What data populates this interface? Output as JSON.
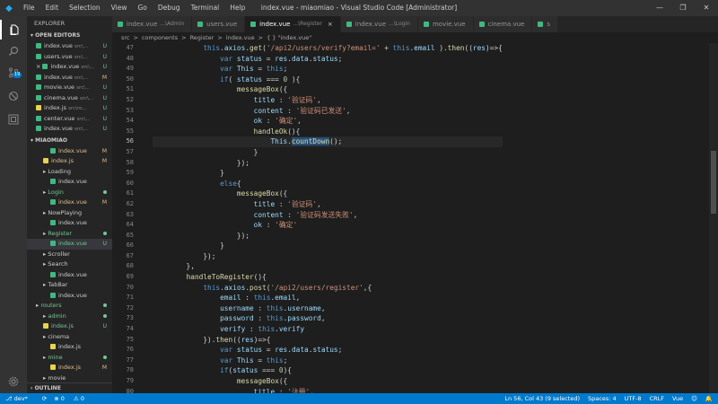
{
  "titlebar": {
    "menu": [
      "File",
      "Edit",
      "Selection",
      "View",
      "Go",
      "Debug",
      "Terminal",
      "Help"
    ],
    "title": "index.vue - miaomiao - Visual Studio Code [Administrator]"
  },
  "activity": {
    "scm_badge": "19"
  },
  "sidebar": {
    "header": "EXPLORER",
    "open_editors": "OPEN EDITORS",
    "open_files": [
      {
        "name": "index.vue",
        "dir": "src\\...",
        "status": "U",
        "type": "vue"
      },
      {
        "name": "users.vue",
        "dir": "src\\...",
        "status": "U",
        "type": "vue"
      },
      {
        "name": "index.vue",
        "dir": "src\\...",
        "status": "U",
        "type": "vue",
        "close": "×"
      },
      {
        "name": "index.vue",
        "dir": "src\\...",
        "status": "M",
        "type": "vue"
      },
      {
        "name": "movie.vue",
        "dir": "src\\...",
        "status": "U",
        "type": "vue"
      },
      {
        "name": "cinema.vue",
        "dir": "src\\...",
        "status": "U",
        "type": "vue"
      },
      {
        "name": "index.js",
        "dir": "src\\ro...",
        "status": "U",
        "type": "js"
      },
      {
        "name": "center.vue",
        "dir": "src\\...",
        "status": "U",
        "type": "vue"
      },
      {
        "name": "index.vue",
        "dir": "src\\...",
        "status": "U",
        "type": "vue"
      }
    ],
    "project": "MIAOMIAO",
    "tree": [
      {
        "label": "index.vue",
        "indent": 3,
        "status": "M",
        "kind": "vue"
      },
      {
        "label": "index.js",
        "indent": 2,
        "status": "M",
        "kind": "js"
      },
      {
        "label": "Loading",
        "indent": 2,
        "status": "",
        "kind": "dir"
      },
      {
        "label": "index.vue",
        "indent": 3,
        "status": "",
        "kind": "vue"
      },
      {
        "label": "Login",
        "indent": 2,
        "status": "dot",
        "kind": "dir"
      },
      {
        "label": "index.vue",
        "indent": 3,
        "status": "M",
        "kind": "vue"
      },
      {
        "label": "NowPlaying",
        "indent": 2,
        "status": "",
        "kind": "dir"
      },
      {
        "label": "index.vue",
        "indent": 3,
        "status": "",
        "kind": "vue"
      },
      {
        "label": "Register",
        "indent": 2,
        "status": "dot",
        "kind": "dir"
      },
      {
        "label": "index.vue",
        "indent": 3,
        "status": "U",
        "kind": "vue",
        "selected": true
      },
      {
        "label": "Scroller",
        "indent": 2,
        "status": "",
        "kind": "dir"
      },
      {
        "label": "Search",
        "indent": 2,
        "status": "",
        "kind": "dir"
      },
      {
        "label": "index.vue",
        "indent": 3,
        "status": "",
        "kind": "vue"
      },
      {
        "label": "TabBar",
        "indent": 2,
        "status": "",
        "kind": "dir"
      },
      {
        "label": "index.vue",
        "indent": 3,
        "status": "",
        "kind": "vue"
      },
      {
        "label": "routers",
        "indent": 1,
        "status": "dot",
        "kind": "dir"
      },
      {
        "label": "admin",
        "indent": 2,
        "status": "dot",
        "kind": "dir"
      },
      {
        "label": "index.js",
        "indent": 2,
        "status": "U",
        "kind": "js"
      },
      {
        "label": "cinema",
        "indent": 2,
        "status": "",
        "kind": "dir"
      },
      {
        "label": "index.js",
        "indent": 3,
        "status": "",
        "kind": "js"
      },
      {
        "label": "mine",
        "indent": 2,
        "status": "dot",
        "kind": "dir"
      },
      {
        "label": "index.js",
        "indent": 3,
        "status": "M",
        "kind": "js"
      },
      {
        "label": "movie",
        "indent": 2,
        "status": "",
        "kind": "dir"
      }
    ],
    "outline": "OUTLINE"
  },
  "tabs": [
    {
      "name": "index.vue",
      "dir": "...\\Admin",
      "active": false
    },
    {
      "name": "users.vue",
      "dir": "",
      "active": false
    },
    {
      "name": "index.vue",
      "dir": "...\\Register",
      "active": true,
      "close": "×"
    },
    {
      "name": "index.vue",
      "dir": "...\\Login",
      "active": false
    },
    {
      "name": "movie.vue",
      "dir": "",
      "active": false
    },
    {
      "name": "cinema.vue",
      "dir": "",
      "active": false
    },
    {
      "name": "s",
      "dir": "",
      "active": false
    }
  ],
  "breadcrumb": [
    "src",
    ">",
    "components",
    ">",
    "Register",
    ">",
    "index.vue",
    ">",
    "{ } \"index.vue\""
  ],
  "editor": {
    "current_line": 56,
    "lines": [
      {
        "n": 47,
        "html": "            <span class=\"k\">this</span>.<span class=\"v\">axios</span>.<span class=\"f\">get</span>(<span class=\"s\">'/api2/users/verify?email='</span> + <span class=\"k\">this</span>.<span class=\"v\">email</span> ).<span class=\"f\">then</span>((<span class=\"v\">res</span>)=>{"
      },
      {
        "n": 48,
        "html": "                <span class=\"k\">var</span> <span class=\"v\">status</span> = <span class=\"v\">res</span>.<span class=\"v\">data</span>.<span class=\"v\">status</span>;"
      },
      {
        "n": 49,
        "html": "                <span class=\"k\">var</span> <span class=\"v\">This</span> = <span class=\"k\">this</span>;"
      },
      {
        "n": 50,
        "html": "                <span class=\"k\">if</span>( <span class=\"v\">status</span> === <span class=\"n\">0</span> ){"
      },
      {
        "n": 51,
        "html": "                    <span class=\"f\">messageBox</span>({"
      },
      {
        "n": 52,
        "html": "                        <span class=\"v\">title</span> : <span class=\"s\">'验证码'</span>,"
      },
      {
        "n": 53,
        "html": "                        <span class=\"v\">content</span> : <span class=\"s\">'验证码已发送'</span>,"
      },
      {
        "n": 54,
        "html": "                        <span class=\"v\">ok</span> : <span class=\"s\">'确定'</span>,"
      },
      {
        "n": 55,
        "html": "                        <span class=\"f\">handleOk</span>(){"
      },
      {
        "n": 56,
        "html": "                            <span class=\"v\">This</span>.<span class=\"f hl\">countDown</span>();"
      },
      {
        "n": 57,
        "html": "                        }"
      },
      {
        "n": 58,
        "html": "                    });"
      },
      {
        "n": 59,
        "html": "                }"
      },
      {
        "n": 60,
        "html": "                <span class=\"k\">else</span>{"
      },
      {
        "n": 61,
        "html": "                    <span class=\"f\">messageBox</span>({"
      },
      {
        "n": 62,
        "html": "                        <span class=\"v\">title</span> : <span class=\"s\">'验证码'</span>,"
      },
      {
        "n": 63,
        "html": "                        <span class=\"v\">content</span> : <span class=\"s\">'验证码发送失败'</span>,"
      },
      {
        "n": 64,
        "html": "                        <span class=\"v\">ok</span> : <span class=\"s\">'确定'</span>"
      },
      {
        "n": 65,
        "html": "                    });"
      },
      {
        "n": 66,
        "html": "                }"
      },
      {
        "n": 67,
        "html": "            });"
      },
      {
        "n": 68,
        "html": "        },"
      },
      {
        "n": 69,
        "html": "        <span class=\"f\">handleToRegister</span>(){"
      },
      {
        "n": 70,
        "html": "            <span class=\"k\">this</span>.<span class=\"v\">axios</span>.<span class=\"f\">post</span>(<span class=\"s\">'/api2/users/register'</span>,{"
      },
      {
        "n": 71,
        "html": "                <span class=\"v\">email</span> : <span class=\"k\">this</span>.<span class=\"v\">email</span>,"
      },
      {
        "n": 72,
        "html": "                <span class=\"v\">username</span> : <span class=\"k\">this</span>.<span class=\"v\">username</span>,"
      },
      {
        "n": 73,
        "html": "                <span class=\"v\">password</span> : <span class=\"k\">this</span>.<span class=\"v\">password</span>,"
      },
      {
        "n": 74,
        "html": "                <span class=\"v\">verify</span> : <span class=\"k\">this</span>.<span class=\"v\">verify</span>"
      },
      {
        "n": 75,
        "html": "            }).<span class=\"f\">then</span>((<span class=\"v\">res</span>)=>{"
      },
      {
        "n": 76,
        "html": "                <span class=\"k\">var</span> <span class=\"v\">status</span> = <span class=\"v\">res</span>.<span class=\"v\">data</span>.<span class=\"v\">status</span>;"
      },
      {
        "n": 77,
        "html": "                <span class=\"k\">var</span> <span class=\"v\">This</span> = <span class=\"k\">this</span>;"
      },
      {
        "n": 78,
        "html": "                <span class=\"k\">if</span>(<span class=\"v\">status</span> === <span class=\"n\">0</span>){"
      },
      {
        "n": 79,
        "html": "                    <span class=\"f\">messageBox</span>({"
      },
      {
        "n": 80,
        "html": "                        <span class=\"v\">title</span> : <span class=\"s\">'注册'</span>,"
      }
    ]
  },
  "statusbar": {
    "branch": "dev*",
    "errors": "0",
    "warnings": "0",
    "position": "Ln 56, Col 43 (9 selected)",
    "spaces": "Spaces: 4",
    "encoding": "UTF-8",
    "eol": "CRLF",
    "language": "Vue"
  }
}
